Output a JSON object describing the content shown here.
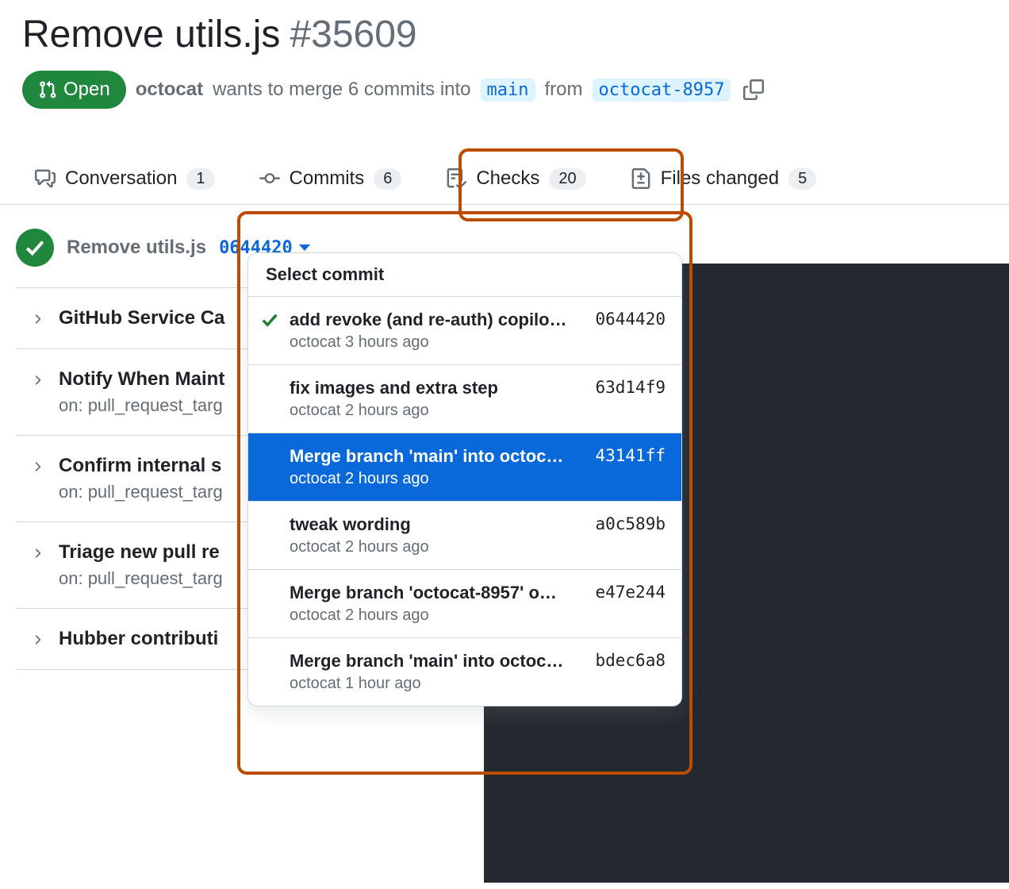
{
  "pr": {
    "title": "Remove utils.js",
    "number": "#35609",
    "state": "Open",
    "author": "octocat",
    "middle_text_1": "wants to merge 6 commits into",
    "base_branch": "main",
    "middle_text_2": "from",
    "head_branch": "octocat-8957"
  },
  "tabs": {
    "conversation": {
      "label": "Conversation",
      "count": "1"
    },
    "commits": {
      "label": "Commits",
      "count": "6"
    },
    "checks": {
      "label": "Checks",
      "count": "20"
    },
    "files": {
      "label": "Files changed",
      "count": "5"
    }
  },
  "current_commit": {
    "title": "Remove utils.js",
    "sha": "0644420"
  },
  "check_groups": [
    {
      "name": "GitHub Service Ca",
      "on": ""
    },
    {
      "name": "Notify When Maint",
      "on": "on: pull_request_targ"
    },
    {
      "name": "Confirm internal s",
      "on": "on: pull_request_targ"
    },
    {
      "name": "Triage new pull re",
      "on": "on: pull_request_targ"
    },
    {
      "name": "Hubber contributi",
      "on": ""
    }
  ],
  "dropdown": {
    "header": "Select commit",
    "items": [
      {
        "title": "add revoke (and re-auth) copilo…",
        "author": "octocat",
        "time": "3 hours ago",
        "sha": "0644420",
        "checked": true,
        "selected": false
      },
      {
        "title": "fix images and extra step",
        "author": "octocat",
        "time": "2 hours ago",
        "sha": "63d14f9",
        "checked": false,
        "selected": false
      },
      {
        "title": "Merge branch 'main' into octoc…",
        "author": "octocat",
        "time": "2 hours ago",
        "sha": "43141ff",
        "checked": false,
        "selected": true
      },
      {
        "title": "tweak wording",
        "author": "octocat",
        "time": "2 hours ago",
        "sha": "a0c589b",
        "checked": false,
        "selected": false
      },
      {
        "title": "Merge branch 'octocat-8957' o…",
        "author": "octocat",
        "time": "2 hours ago",
        "sha": "e47e244",
        "checked": false,
        "selected": false
      },
      {
        "title": "Merge branch 'main' into octoc…",
        "author": "octocat",
        "time": "1 hour ago",
        "sha": "bdec6a8",
        "checked": false,
        "selected": false
      }
    ]
  }
}
